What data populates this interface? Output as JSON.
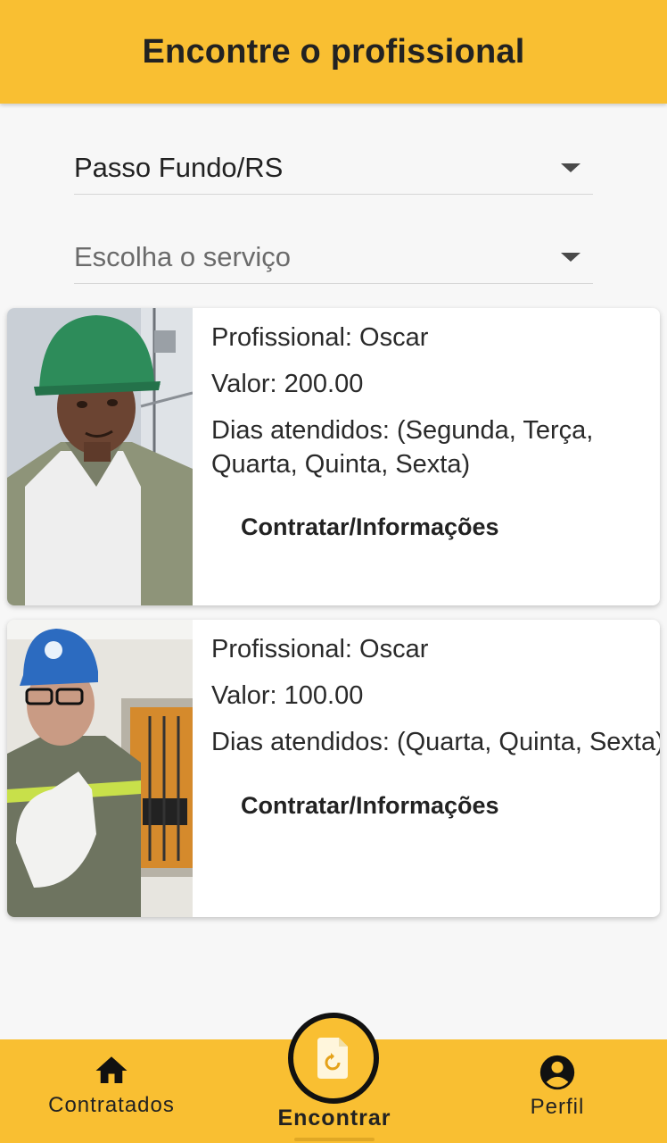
{
  "header": {
    "title": "Encontre o profissional"
  },
  "filters": {
    "city": "Passo Fundo/RS",
    "service_placeholder": "Escolha o serviço"
  },
  "professionals": [
    {
      "name_line": "Profissional: Oscar",
      "price_line": "Valor: 200.00",
      "days_line": "Dias atendidos: (Segunda, Terça, Quarta, Quinta, Sexta)",
      "action": "Contratar/Informações"
    },
    {
      "name_line": "Profissional: Oscar",
      "price_line": "Valor: 100.00",
      "days_line": "Dias atendidos: (Quarta, Quinta, Sexta)",
      "action": "Contratar/Informações"
    }
  ],
  "nav": {
    "contratados": "Contratados",
    "encontrar": "Encontrar",
    "perfil": "Perfil"
  },
  "icons": [
    "caret-down-icon",
    "home-icon",
    "document-refresh-icon",
    "account-circle-icon"
  ],
  "colors": {
    "accent": "#f9bf32",
    "text": "#222222"
  }
}
